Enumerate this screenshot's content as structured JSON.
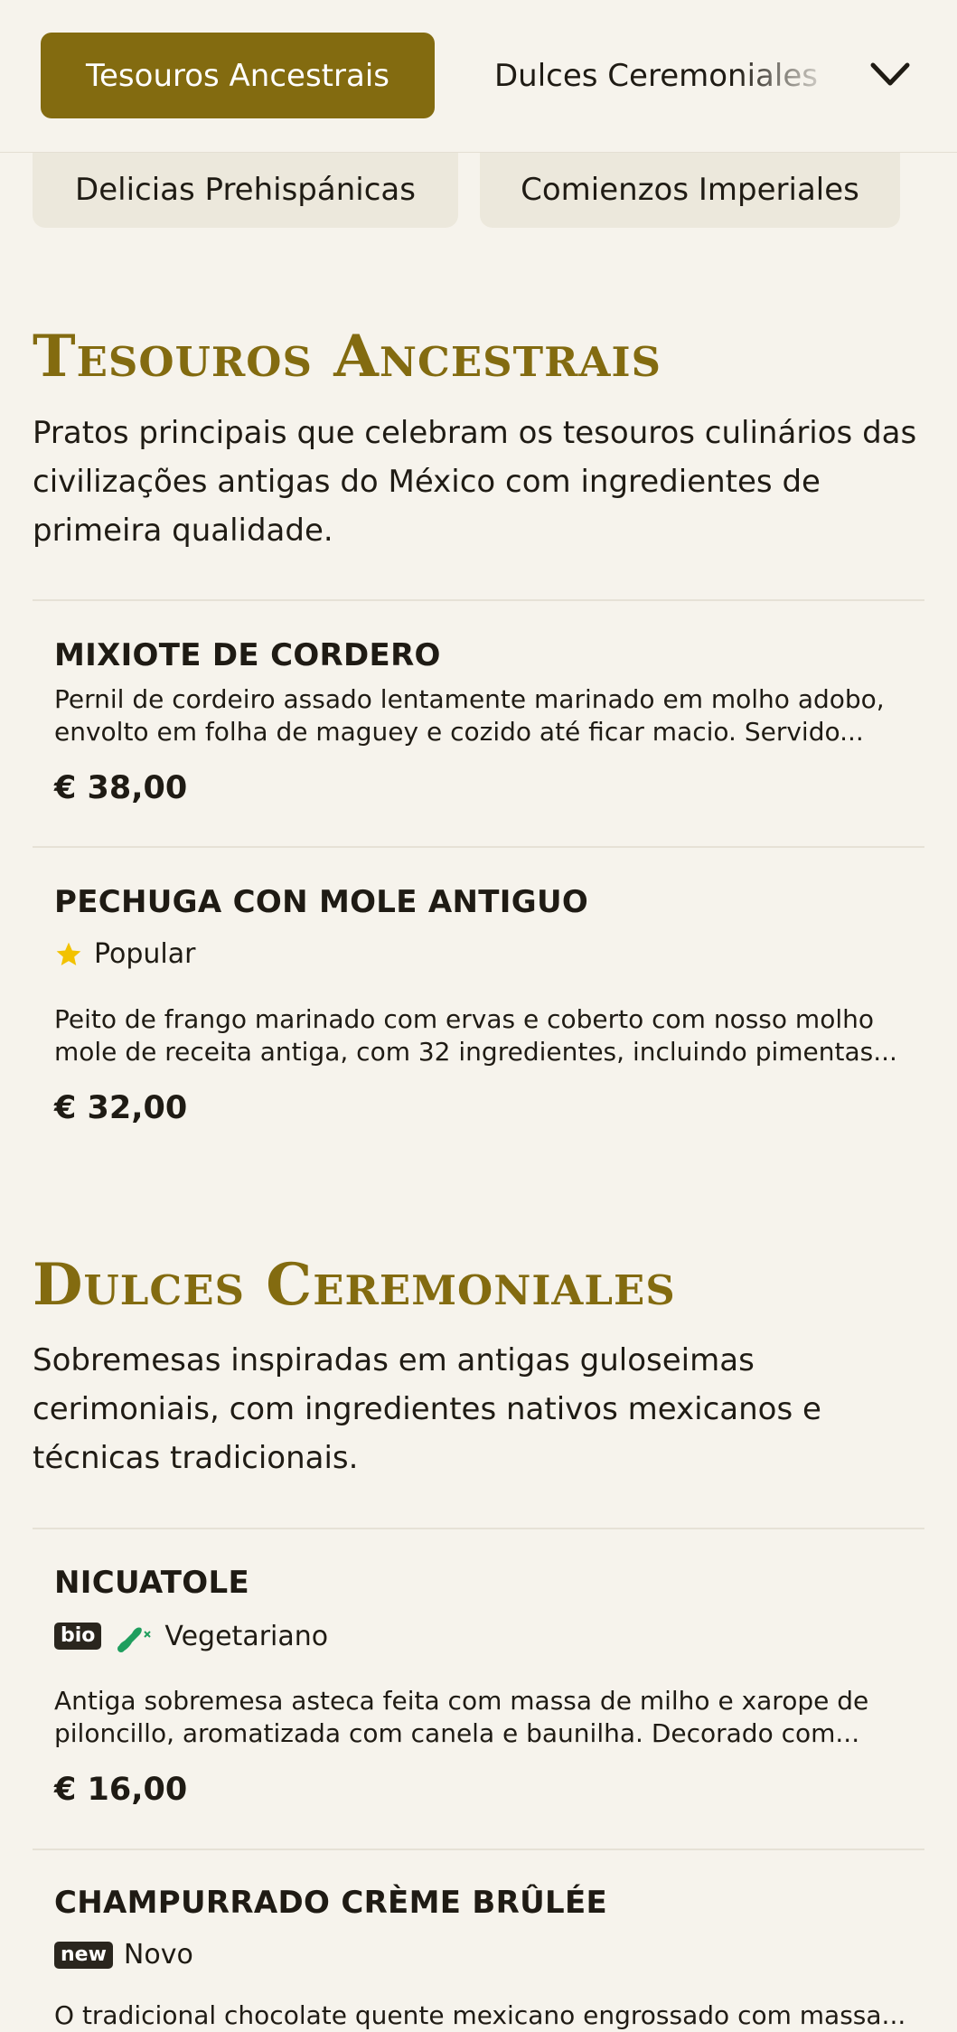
{
  "topbar": {
    "active_tab": "Tesouros Ancestrais",
    "next_tab": "Dulces Ceremoniales",
    "chevron_icon": "chevron-down-icon"
  },
  "secondary_tabs": [
    "Delicias Prehispánicas",
    "Comienzos Imperiales"
  ],
  "sections": [
    {
      "title": "Tesouros Ancestrais",
      "description": "Pratos principais que celebram os tesouros culinários das civilizações antigas do México com ingredientes de primeira qualidade.",
      "items": [
        {
          "name": "MIXIOTE DE CORDERO",
          "description": "Pernil de cordeiro assado lentamente marinado em molho adobo, envolto em folha de maguey e cozido até ficar macio. Servido...",
          "price": "€ 38,00"
        },
        {
          "name": "PECHUGA CON MOLE ANTIGUO",
          "tag": {
            "icon": "star-icon",
            "label": "Popular"
          },
          "description": "Peito de frango marinado com ervas e coberto com nosso molho mole de receita antiga, com 32 ingredientes, incluindo pimentas...",
          "price": "€ 32,00"
        }
      ]
    },
    {
      "title": "Dulces Ceremoniales",
      "description": "Sobremesas inspiradas em antigas guloseimas cerimoniais, com ingredientes nativos mexicanos e técnicas tradicionais.",
      "items": [
        {
          "name": "NICUATOLE",
          "tag": {
            "badge": "bio",
            "icon": "vegetarian-leg-icon",
            "label": "Vegetariano"
          },
          "description": "Antiga sobremesa asteca feita com massa de milho e xarope de piloncillo, aromatizada com canela e baunilha. Decorado com...",
          "price": "€ 16,00"
        },
        {
          "name": "CHAMPURRADO CRÈME BRÛLÉE",
          "tag": {
            "badge": "new",
            "label": "Novo"
          },
          "description": "O tradicional chocolate quente mexicano engrossado com massa..."
        }
      ]
    }
  ],
  "colors": {
    "accent": "#836b10",
    "background": "#f6f3ec",
    "star": "#f2c200",
    "vegetarian": "#1f9e5e"
  }
}
